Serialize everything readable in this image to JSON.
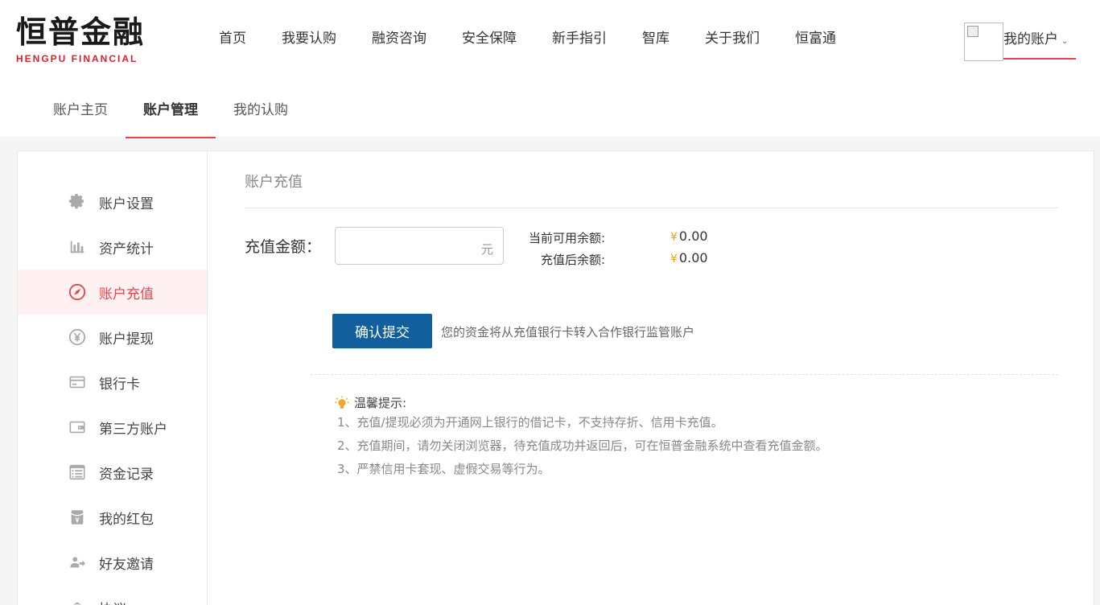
{
  "logo": {
    "cn": "恒普金融",
    "en": "HENGPU FINANCIAL"
  },
  "nav": [
    "首页",
    "我要认购",
    "融资咨询",
    "安全保障",
    "新手指引",
    "智库",
    "关于我们",
    "恒富通"
  ],
  "account": {
    "label": "我的账户",
    "chevron": "⌄"
  },
  "subnav": [
    {
      "label": "账户主页",
      "active": false
    },
    {
      "label": "账户管理",
      "active": true
    },
    {
      "label": "我的认购",
      "active": false
    }
  ],
  "sidebar": {
    "items": [
      {
        "label": "账户设置",
        "icon": "gear-icon"
      },
      {
        "label": "资产统计",
        "icon": "bar-chart-icon"
      },
      {
        "label": "账户充值",
        "icon": "compass-icon",
        "active": true
      },
      {
        "label": "账户提现",
        "icon": "yen-circle-icon"
      },
      {
        "label": "银行卡",
        "icon": "bank-card-icon"
      },
      {
        "label": "第三方账户",
        "icon": "wallet-icon"
      },
      {
        "label": "资金记录",
        "icon": "list-icon"
      },
      {
        "label": "我的红包",
        "icon": "red-packet-icon"
      },
      {
        "label": "好友邀请",
        "icon": "invite-icon"
      },
      {
        "label": "协议",
        "icon": "agreement-icon"
      }
    ]
  },
  "content": {
    "title": "账户充值",
    "amount_label": "充值金额：",
    "amount_value": "",
    "unit": "元",
    "balance": {
      "current_label": "当前可用余额:",
      "current_value": "0.00",
      "after_label": "充值后余额:",
      "after_value": "0.00",
      "currency": "¥"
    },
    "submit_label": "确认提交",
    "submit_note": "您的资金将从充值银行卡转入合作银行监管账户",
    "tips": {
      "title": "温馨提示:",
      "lines": [
        "1、充值/提现必须为开通网上银行的借记卡，不支持存折、信用卡充值。",
        "2、充值期间，请勿关闭浏览器，待充值成功并返回后，可在恒普金融系统中查看充值金额。",
        "3、严禁信用卡套现、虚假交易等行为。"
      ]
    }
  },
  "colors": {
    "accent": "#e8434e",
    "button": "#125f9e",
    "yen": "#f0a020",
    "bulb": "#f5a623"
  }
}
